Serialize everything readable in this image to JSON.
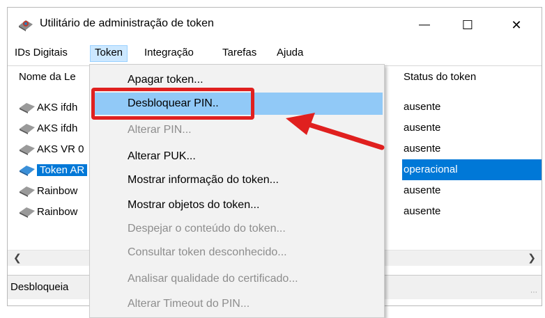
{
  "window": {
    "title": "Utilitário de administração de token",
    "buttons": {
      "minimize": "—",
      "maximize": "☐",
      "close": "✕"
    }
  },
  "menubar": {
    "items": [
      {
        "label": "IDs Digitais"
      },
      {
        "label": "Token"
      },
      {
        "label": "Integração"
      },
      {
        "label": "Tarefas"
      },
      {
        "label": "Ajuda"
      }
    ]
  },
  "list": {
    "columns": {
      "name": "Nome da Le",
      "status": "Status do token"
    },
    "rows": [
      {
        "name": "AKS ifdh",
        "status": "ausente",
        "selected": false
      },
      {
        "name": "AKS ifdh",
        "status": "ausente",
        "selected": false
      },
      {
        "name": "AKS VR 0",
        "status": "ausente",
        "selected": false
      },
      {
        "name": "Token AR",
        "status": "operacional",
        "selected": true
      },
      {
        "name": "Rainbow",
        "status": "ausente",
        "selected": false
      },
      {
        "name": "Rainbow",
        "status": "ausente",
        "selected": false
      }
    ]
  },
  "statusbar": {
    "text": "Desbloqueia"
  },
  "token_menu": {
    "items": [
      {
        "label": "Apagar token...",
        "disabled": false
      },
      {
        "label": "Desbloquear PIN..",
        "disabled": false,
        "hover": true
      },
      {
        "label": "Alterar PIN...",
        "disabled": true
      },
      {
        "label": "Alterar PUK...",
        "disabled": false
      },
      {
        "label": "Mostrar informação do token...",
        "disabled": false
      },
      {
        "label": "Mostrar objetos do token...",
        "disabled": false
      },
      {
        "label": "Despejar o conteúdo do token...",
        "disabled": true
      },
      {
        "label": "Consultar token desconhecido...",
        "disabled": true
      },
      {
        "label": "Analisar qualidade do certificado...",
        "disabled": true
      },
      {
        "label": "Alterar Timeout do PIN...",
        "disabled": true
      }
    ]
  },
  "colors": {
    "selection": "#0078d7",
    "menu_hover": "#91c9f7",
    "annotation": "#e0201f"
  },
  "icons": {
    "app": "token-app-icon",
    "reader": "card-reader-icon"
  }
}
